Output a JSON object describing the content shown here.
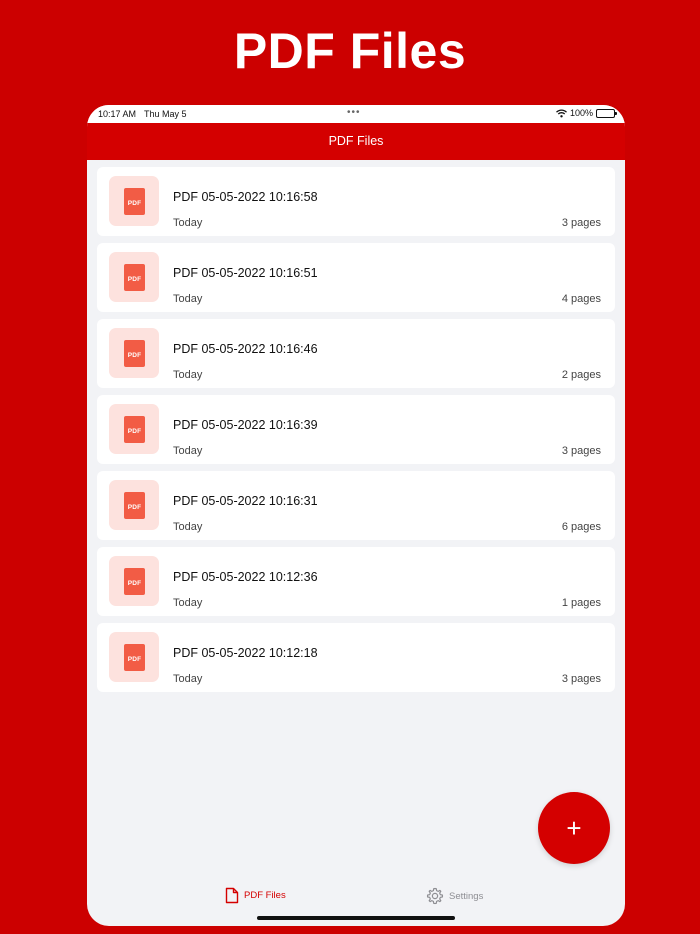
{
  "promo": {
    "title": "PDF Files"
  },
  "status_bar": {
    "time": "10:17 AM",
    "date": "Thu May 5",
    "battery": "100%"
  },
  "nav": {
    "title": "PDF Files"
  },
  "files": [
    {
      "name": "PDF 05-05-2022 10:16:58",
      "date": "Today",
      "pages": "3 pages",
      "icon_label": "PDF"
    },
    {
      "name": "PDF 05-05-2022 10:16:51",
      "date": "Today",
      "pages": "4 pages",
      "icon_label": "PDF"
    },
    {
      "name": "PDF 05-05-2022 10:16:46",
      "date": "Today",
      "pages": "2 pages",
      "icon_label": "PDF"
    },
    {
      "name": "PDF 05-05-2022 10:16:39",
      "date": "Today",
      "pages": "3 pages",
      "icon_label": "PDF"
    },
    {
      "name": "PDF 05-05-2022 10:16:31",
      "date": "Today",
      "pages": "6 pages",
      "icon_label": "PDF"
    },
    {
      "name": "PDF 05-05-2022 10:12:36",
      "date": "Today",
      "pages": "1 pages",
      "icon_label": "PDF"
    },
    {
      "name": "PDF 05-05-2022 10:12:18",
      "date": "Today",
      "pages": "3 pages",
      "icon_label": "PDF"
    }
  ],
  "fab": {
    "label": "+"
  },
  "tabs": [
    {
      "label": "PDF Files",
      "icon": "document-icon",
      "active": true
    },
    {
      "label": "Settings",
      "icon": "gear-icon",
      "active": false
    }
  ],
  "colors": {
    "background": "#cc0000",
    "accent": "#d40000",
    "pdf_icon": "#f25c45",
    "pdf_icon_bg": "#fde2de",
    "inactive_tab": "#8e8e93"
  }
}
